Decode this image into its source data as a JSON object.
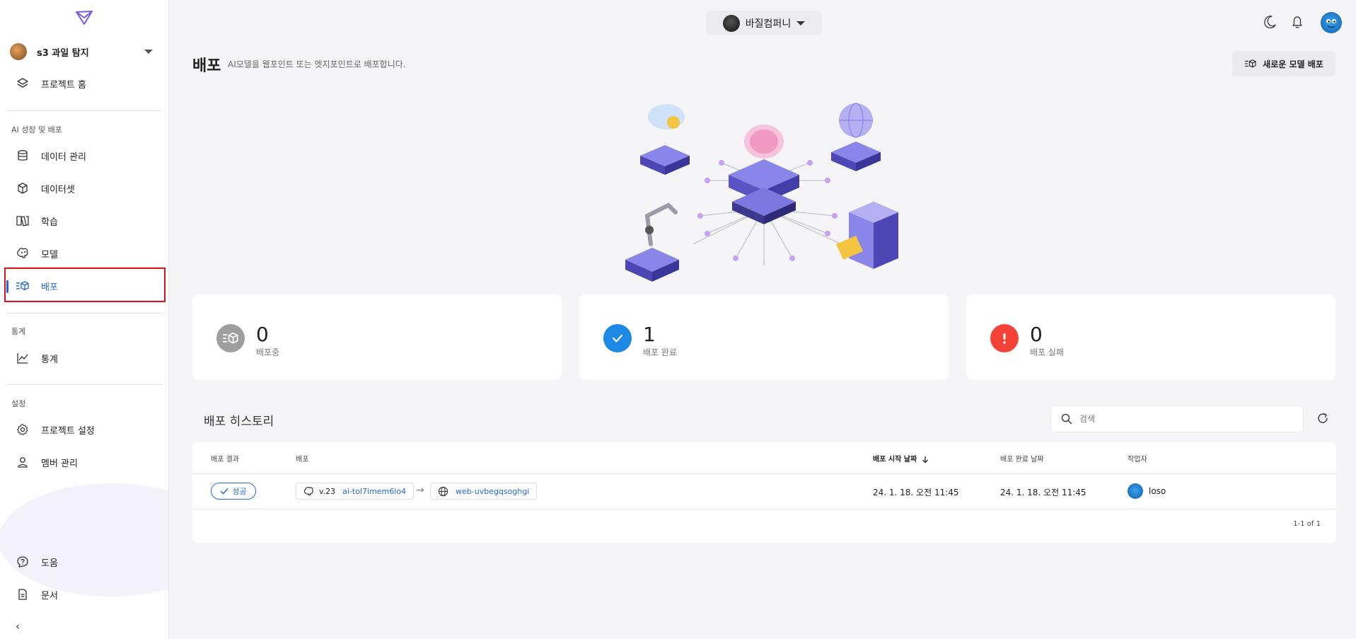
{
  "sidebar": {
    "project_name": "s3 과일 탐지",
    "home": "프로젝트 홈",
    "section_ai": "AI 성장 및 배포",
    "items_ai": [
      "데이터 관리",
      "데이터셋",
      "학습",
      "모델",
      "배포"
    ],
    "section_stats": "통계",
    "stats": "통계",
    "section_settings": "설정",
    "project_settings": "프로젝트 설정",
    "members": "멤버 관리",
    "help": "도움",
    "docs": "문서",
    "collapse_icon": "‹"
  },
  "topbar": {
    "org_name": "바질컴퍼니"
  },
  "header": {
    "title": "배포",
    "description": "AI모델을 웹포인트 또는 엣지포인트로 배포합니다.",
    "new_button": "새로운 모델 배포"
  },
  "stats": [
    {
      "value": "0",
      "label": "배포중",
      "color": "#9e9e9e"
    },
    {
      "value": "1",
      "label": "배포 완료",
      "color": "#1e88e5"
    },
    {
      "value": "0",
      "label": "배포 실패",
      "color": "#f44336"
    }
  ],
  "history": {
    "title": "배포 히스토리",
    "search_placeholder": "검색",
    "columns": [
      "배포 결과",
      "배포",
      "배포 시작 날짜",
      "배포 완료 날짜",
      "작업자"
    ],
    "rows": [
      {
        "result": "성공",
        "version": "v.23",
        "model": "ai-tol7imem6lo4",
        "endpoint": "web-uvbegqsoghgi",
        "start": "24. 1. 18. 오전 11:45",
        "end": "24. 1. 18. 오전 11:45",
        "worker": "loso"
      }
    ],
    "pagination": "1-1 of 1"
  },
  "colors": {
    "accent": "#2468d8",
    "highlight_border": "#e0101a"
  }
}
